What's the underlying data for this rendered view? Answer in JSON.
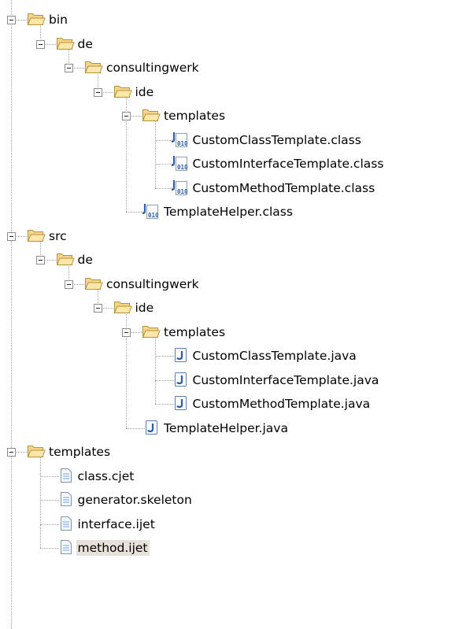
{
  "tree": [
    {
      "label": "bin",
      "type": "folder",
      "depth": 0,
      "expanded": true
    },
    {
      "label": "de",
      "type": "folder",
      "depth": 1,
      "expanded": true
    },
    {
      "label": "consultingwerk",
      "type": "folder",
      "depth": 2,
      "expanded": true
    },
    {
      "label": "ide",
      "type": "folder",
      "depth": 3,
      "expanded": true
    },
    {
      "label": "templates",
      "type": "folder",
      "depth": 4,
      "expanded": true
    },
    {
      "label": "CustomClassTemplate.class",
      "type": "class",
      "depth": 5
    },
    {
      "label": "CustomInterfaceTemplate.class",
      "type": "class",
      "depth": 5
    },
    {
      "label": "CustomMethodTemplate.class",
      "type": "class",
      "depth": 5
    },
    {
      "label": "TemplateHelper.class",
      "type": "class",
      "depth": 4
    },
    {
      "label": "src",
      "type": "folder",
      "depth": 0,
      "expanded": true
    },
    {
      "label": "de",
      "type": "folder",
      "depth": 1,
      "expanded": true
    },
    {
      "label": "consultingwerk",
      "type": "folder",
      "depth": 2,
      "expanded": true
    },
    {
      "label": "ide",
      "type": "folder",
      "depth": 3,
      "expanded": true
    },
    {
      "label": "templates",
      "type": "folder",
      "depth": 4,
      "expanded": true
    },
    {
      "label": "CustomClassTemplate.java",
      "type": "java",
      "depth": 5
    },
    {
      "label": "CustomInterfaceTemplate.java",
      "type": "java",
      "depth": 5
    },
    {
      "label": "CustomMethodTemplate.java",
      "type": "java",
      "depth": 5
    },
    {
      "label": "TemplateHelper.java",
      "type": "java",
      "depth": 4
    },
    {
      "label": "templates",
      "type": "folder",
      "depth": 0,
      "expanded": true
    },
    {
      "label": "class.cjet",
      "type": "file",
      "depth": 1
    },
    {
      "label": "generator.skeleton",
      "type": "file",
      "depth": 1
    },
    {
      "label": "interface.ijet",
      "type": "file",
      "depth": 1
    },
    {
      "label": "method.ijet",
      "type": "file",
      "depth": 1,
      "selected": true
    }
  ]
}
